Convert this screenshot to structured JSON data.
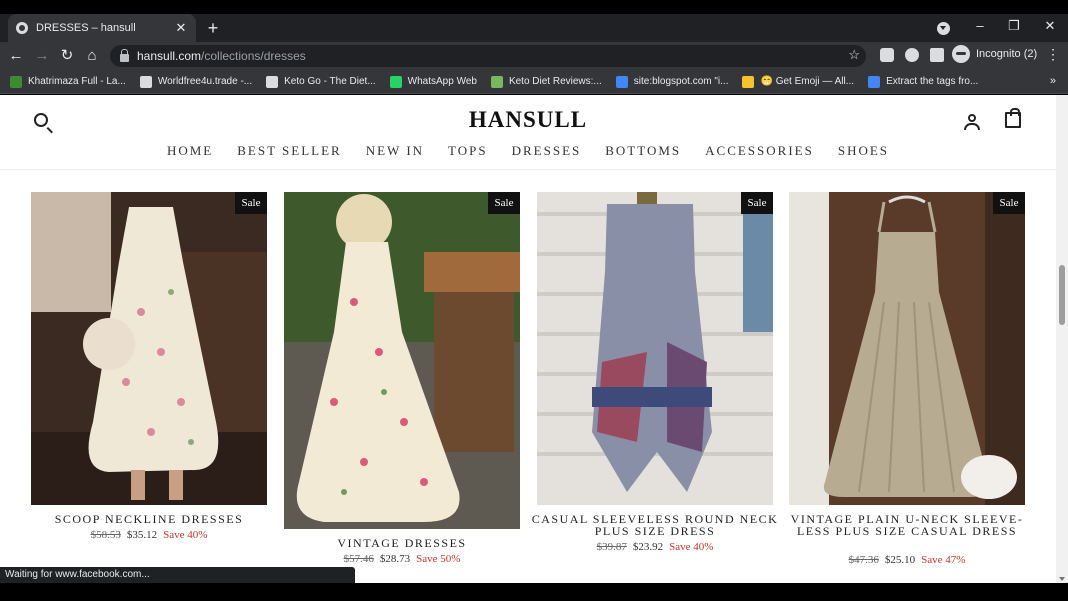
{
  "browser": {
    "tab_title": "DRESSES – hansull",
    "tab_close": "✕",
    "new_tab": "+",
    "window_controls": {
      "minimize": "–",
      "restore": "❐",
      "close": "✕"
    },
    "url_host": "hansull.com",
    "url_path": "/collections/dresses",
    "bookmark_star": "☆",
    "profile_label": "Incognito (2)",
    "menu": "⋮",
    "nav": {
      "back": "←",
      "forward": "→",
      "reload": "↻",
      "home": "⌂"
    },
    "bookmarks": [
      {
        "label": "Khatrimaza Full - La...",
        "color": "#3c8d2f"
      },
      {
        "label": "Worldfree4u.trade -...",
        "color": "#dadce0"
      },
      {
        "label": "Keto Go - The Diet...",
        "color": "#dadce0"
      },
      {
        "label": "WhatsApp Web",
        "color": "#25d366"
      },
      {
        "label": "Keto Diet Reviews:...",
        "color": "#7bb661"
      },
      {
        "label": "site:blogspot.com \"i...",
        "color": "#4285f4"
      },
      {
        "label": "😁 Get Emoji — All...",
        "color": "#f4c430"
      },
      {
        "label": "Extract the tags fro...",
        "color": "#4285f4"
      }
    ],
    "bookmarks_more": "»",
    "status_text": "Waiting for www.facebook.com..."
  },
  "site": {
    "logo": "HANSULL",
    "nav": [
      "HOME",
      "BEST SELLER",
      "NEW IN",
      "TOPS",
      "DRESSES",
      "BOTTOMS",
      "ACCESSORIES",
      "SHOES"
    ]
  },
  "products": [
    {
      "name": "SCOOP NECKLINE DRESSES",
      "badge": "Sale",
      "old_price": "$58.53",
      "price": "$35.12",
      "save": "Save 40%"
    },
    {
      "name": "VINTAGE DRESSES",
      "badge": "Sale",
      "old_price": "$57.46",
      "price": "$28.73",
      "save": "Save 50%"
    },
    {
      "name": "CASUAL SLEEVELESS ROUND NECK PLUS SIZE DRESS",
      "badge": "Sale",
      "old_price": "$39.87",
      "price": "$23.92",
      "save": "Save 40%"
    },
    {
      "name": "VINTAGE PLAIN U-NECK SLEEVE-LESS PLUS SIZE CASUAL DRESS",
      "badge": "Sale",
      "old_price": "$47.36",
      "price": "$25.10",
      "save": "Save 47%"
    }
  ]
}
